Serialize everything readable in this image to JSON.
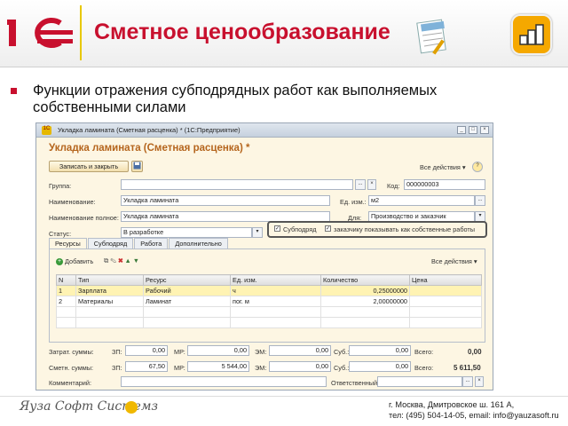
{
  "header": {
    "title": "Сметное ценообразование",
    "logo_text": "1С",
    "colors": {
      "accent": "#c8102e",
      "logo_bar": "#e8c800",
      "corner_icon": "#f5a800"
    }
  },
  "slide": {
    "bullet_text": "Функции отражения субподрядных работ как выполняемых собственными силами"
  },
  "window": {
    "title": "Укладка ламината (Сметная расценка) * (1С:Предприятие)",
    "titlebar_buttons": [
      "minimize",
      "maximize",
      "close"
    ],
    "header_title": "Укладка ламината (Сметная расценка) *",
    "toolbar": {
      "save_close_label": "Записать и закрыть",
      "actions_label": "Все действия",
      "help_label": "?"
    },
    "form": {
      "group_label": "Группа:",
      "group_value": "",
      "code_label": "Код:",
      "code_value": "000000003",
      "name_label": "Наименование:",
      "name_value": "Укладка ламината",
      "unit_label": "Ед. изм.:",
      "unit_value": "м2",
      "fullname_label": "Наименование полное:",
      "fullname_value": "Укладка ламината",
      "for_label": "Для:",
      "for_value": "Производство и заказчик",
      "status_label": "Статус:",
      "status_value": "В разработке",
      "subcontract_label": "Субподряд",
      "subcontract_checked": true,
      "customer_show_label": "заказчику показывать как собственные работы",
      "customer_show_checked": true
    },
    "tabs": [
      "Ресурсы",
      "Субподряд",
      "Работа",
      "Дополнительно"
    ],
    "active_tab": "Ресурсы",
    "table_toolbar": {
      "add_label": "Добавить",
      "actions_label": "Все действия"
    },
    "table": {
      "columns": [
        "N",
        "Тип",
        "Ресурс",
        "Ед. изм.",
        "Количество",
        "Цена"
      ],
      "rows": [
        {
          "n": "1",
          "type": "Зарплата",
          "resource": "Рабочий",
          "unit": "ч",
          "qty": "0,25000000",
          "price": "",
          "selected": true
        },
        {
          "n": "2",
          "type": "Материалы",
          "resource": "Ламинат",
          "unit": "пог. м",
          "qty": "2,00000000",
          "price": ""
        }
      ]
    },
    "totals": {
      "cost_label": "Затрат. суммы:",
      "smeta_label": "Сметн. суммы:",
      "zp_label": "ЗП:",
      "mr_label": "МР:",
      "em_label": "ЭМ:",
      "sub_label": "Суб.:",
      "total_label": "Всего:",
      "cost": {
        "zp": "0,00",
        "mr": "0,00",
        "em": "0,00",
        "sub": "0,00",
        "total": "0,00"
      },
      "smeta": {
        "zp": "67,50",
        "mr": "5 544,00",
        "em": "0,00",
        "sub": "0,00",
        "total": "5 611,50"
      },
      "comment_label": "Комментарий:",
      "responsible_label": "Ответственный:"
    }
  },
  "footer": {
    "brand": "Яуза Софт Системз",
    "address_line1": "г. Москва, Дмитровское ш. 161 А,",
    "address_line2": "тел: (495) 504-14-05, email: info@yauzasoft.ru"
  }
}
